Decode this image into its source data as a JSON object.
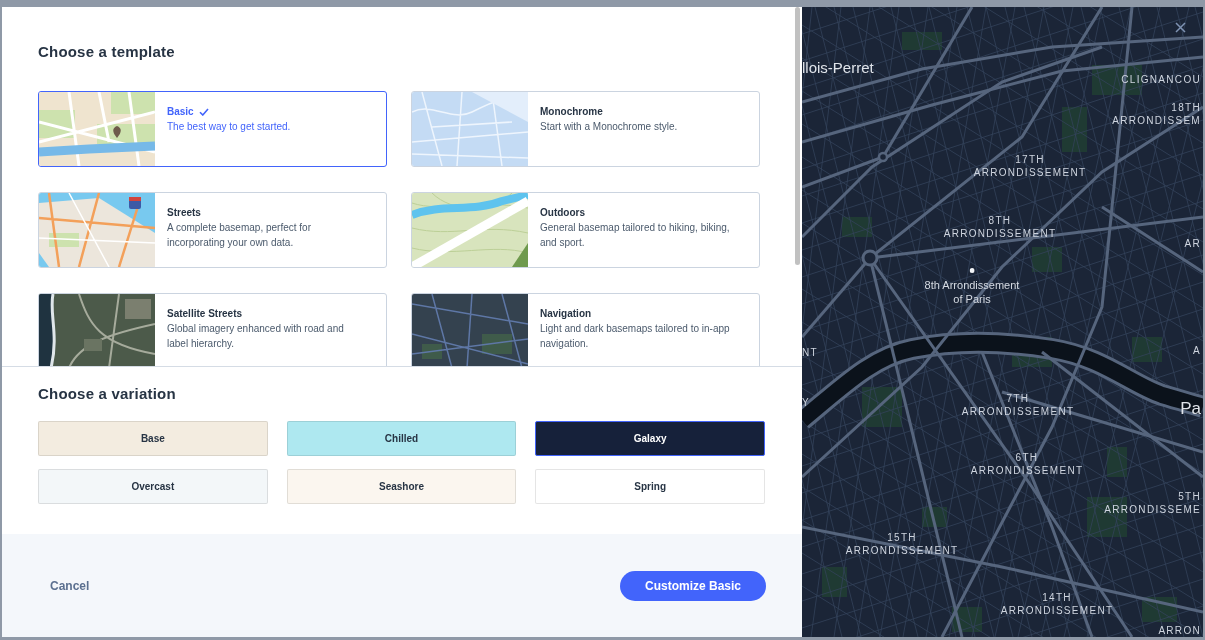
{
  "dialog": {
    "template_heading": "Choose a template",
    "templates": [
      {
        "name": "Basic",
        "description": "The best way to get started.",
        "kind": "light",
        "selected": true
      },
      {
        "name": "Monochrome",
        "description": "Start with a Monochrome style.",
        "kind": "mono",
        "selected": false
      },
      {
        "name": "Streets",
        "description": "A complete basemap, perfect for incorporating your own data.",
        "kind": "streets",
        "selected": false
      },
      {
        "name": "Outdoors",
        "description": "General basemap tailored to hiking, biking, and sport.",
        "kind": "outdoors",
        "selected": false
      },
      {
        "name": "Satellite Streets",
        "description": "Global imagery enhanced with road and label hierarchy.",
        "kind": "satellite",
        "selected": false
      },
      {
        "name": "Navigation",
        "description": "Light and dark basemaps tailored to in-app navigation.",
        "kind": "dark",
        "selected": false
      }
    ],
    "variation_heading": "Choose a variation",
    "variations": [
      {
        "label": "Base",
        "color": "#f3ece0",
        "selected": false
      },
      {
        "label": "Chilled",
        "color": "#aee8f0",
        "selected": false
      },
      {
        "label": "Galaxy",
        "color": "#16213a",
        "selected": true
      },
      {
        "label": "Overcast",
        "color": "#f3f7f9",
        "selected": false
      },
      {
        "label": "Seashore",
        "color": "#fbf6ef",
        "selected": false
      },
      {
        "label": "Spring",
        "color": "#ffffff",
        "selected": false
      }
    ],
    "cancel_button": "Cancel",
    "customize_button": "Customize Basic"
  },
  "map_preview": {
    "labels": [
      {
        "kind": "place",
        "lines": [
          "llois-Perret"
        ]
      },
      {
        "kind": "district",
        "lines": [
          "CLIGNANCOU"
        ]
      },
      {
        "kind": "district",
        "lines": [
          "18TH",
          "ARRONDISSEM"
        ]
      },
      {
        "kind": "district",
        "lines": [
          "17TH",
          "ARRONDISSEMENT"
        ]
      },
      {
        "kind": "district",
        "lines": [
          "8TH",
          "ARRONDISSEMENT"
        ]
      },
      {
        "kind": "district",
        "lines": [
          "AR"
        ]
      },
      {
        "kind": "poi",
        "lines": [
          "8th Arrondissement",
          "of Paris"
        ]
      },
      {
        "kind": "district",
        "lines": [
          "NT"
        ]
      },
      {
        "kind": "district",
        "lines": [
          "Y"
        ]
      },
      {
        "kind": "district",
        "lines": [
          "A"
        ]
      },
      {
        "kind": "district",
        "lines": [
          "7TH",
          "ARRONDISSEMENT"
        ]
      },
      {
        "kind": "place",
        "lines": [
          "Pa"
        ]
      },
      {
        "kind": "district",
        "lines": [
          "6TH",
          "ARRONDISSEMENT"
        ]
      },
      {
        "kind": "district",
        "lines": [
          "5TH",
          "ARRONDISSEME"
        ]
      },
      {
        "kind": "district",
        "lines": [
          "15TH",
          "ARRONDISSEMENT"
        ]
      },
      {
        "kind": "district",
        "lines": [
          "14TH",
          "ARRONDISSEMENT"
        ]
      },
      {
        "kind": "district",
        "lines": [
          "ARRON"
        ]
      }
    ]
  }
}
